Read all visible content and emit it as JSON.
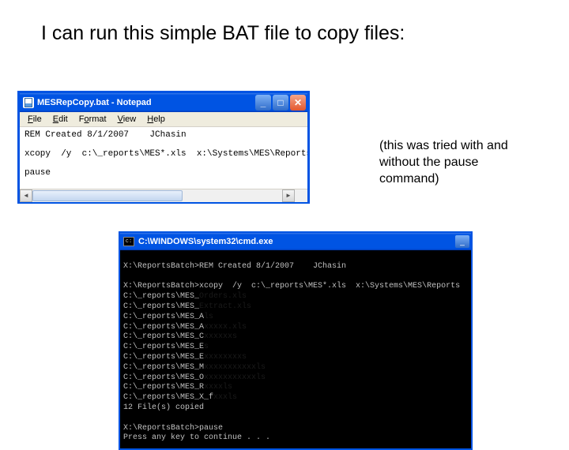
{
  "slide": {
    "title": "I can run this simple BAT file to copy files:",
    "annotation": "(this was tried with and without the pause command)"
  },
  "notepad": {
    "title": "MESRepCopy.bat - Notepad",
    "menu": {
      "file": "File",
      "edit": "Edit",
      "format": "Format",
      "view": "View",
      "help": "Help"
    },
    "lines": {
      "l1": "REM Created 8/1/2007    JChasin",
      "l2": "",
      "l3": "xcopy  /y  c:\\_reports\\MES*.xls  x:\\Systems\\MES\\Reports",
      "l4": "",
      "l5": "pause"
    }
  },
  "cmd": {
    "title": "C:\\WINDOWS\\system32\\cmd.exe",
    "lines": {
      "l0": "",
      "l1": "X:\\ReportsBatch>REM Created 8/1/2007    JChasin",
      "l2": "",
      "l3": "X:\\ReportsBatch>xcopy  /y  c:\\_reports\\MES*.xls  x:\\Systems\\MES\\Reports",
      "l4a": "C:\\_reports\\MES_",
      "l4b": "Orders.xls",
      "l5a": "C:\\_reports\\MES_",
      "l5b": "Extract.xls",
      "l6a": "C:\\_reports\\MES_A",
      "l6b": "ls",
      "l7a": "C:\\_reports\\MES_A",
      "l7b": "xxxxx.xls",
      "l8a": "C:\\_reports\\MES_C",
      "l8b": "xxxxxxs",
      "l9a": "C:\\_reports\\MES_E",
      "l9b": "s",
      "l10a": "C:\\_reports\\MES_E",
      "l10b": "xxxxxxxxs",
      "l11a": "C:\\_reports\\MES_M",
      "l11b": "xxxxxxxxxxxls",
      "l12a": "C:\\_reports\\MES_O",
      "l12b": "xxxxxxxxxxxls",
      "l13a": "C:\\_reports\\MES_R",
      "l13b": "xxxxls",
      "l14a": "C:\\_reports\\MES_X_f",
      "l14b": "xxxls",
      "l15": "12 File(s) copied",
      "l16": "",
      "l17": "X:\\ReportsBatch>pause",
      "l18": "Press any key to continue . . ."
    }
  }
}
